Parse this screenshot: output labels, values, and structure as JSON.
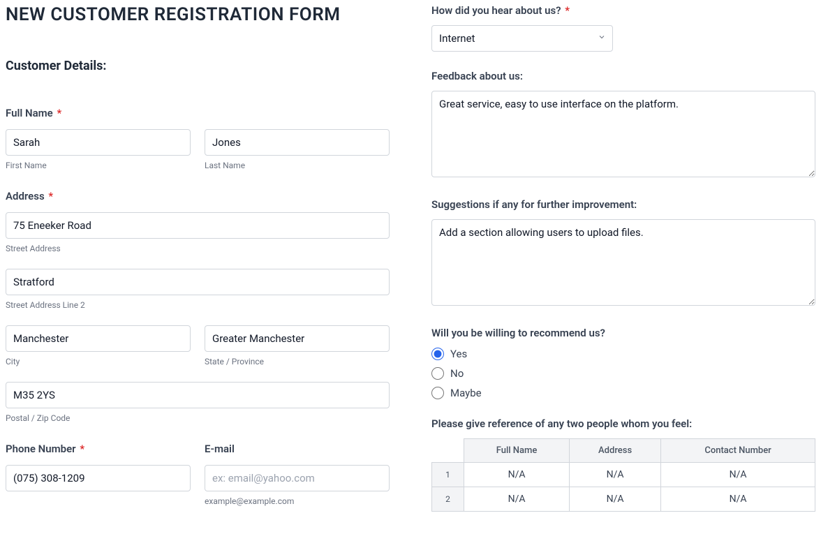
{
  "title": "NEW CUSTOMER REGISTRATION FORM",
  "section_title": "Customer Details:",
  "full_name": {
    "label": "Full Name",
    "first_value": "Sarah",
    "first_sub": "First Name",
    "last_value": "Jones",
    "last_sub": "Last Name"
  },
  "address": {
    "label": "Address",
    "street_value": "75 Eneeker Road",
    "street_sub": "Street Address",
    "street2_value": "Stratford",
    "street2_sub": "Street Address Line 2",
    "city_value": "Manchester",
    "city_sub": "City",
    "state_value": "Greater Manchester",
    "state_sub": "State / Province",
    "postal_value": "M35 2YS",
    "postal_sub": "Postal / Zip Code"
  },
  "phone": {
    "label": "Phone Number",
    "value": "(075) 308-1209"
  },
  "email": {
    "label": "E-mail",
    "placeholder": "ex: email@yahoo.com",
    "sub": "example@example.com"
  },
  "hear": {
    "label": "How did you hear about us?",
    "value": "Internet"
  },
  "feedback": {
    "label": "Feedback about us:",
    "value": "Great service, easy to use interface on the platform."
  },
  "suggestions": {
    "label": "Suggestions if any for further improvement:",
    "value": "Add a section allowing users to upload files."
  },
  "recommend": {
    "label": "Will you be willing to recommend us?",
    "options": {
      "yes": "Yes",
      "no": "No",
      "maybe": "Maybe"
    },
    "selected": "yes"
  },
  "references": {
    "label": "Please give reference of any two people whom you feel:",
    "headers": {
      "name": "Full Name",
      "addr": "Address",
      "contact": "Contact Number"
    },
    "rows": [
      {
        "idx": "1",
        "name": "N/A",
        "addr": "N/A",
        "contact": "N/A"
      },
      {
        "idx": "2",
        "name": "N/A",
        "addr": "N/A",
        "contact": "N/A"
      }
    ]
  }
}
